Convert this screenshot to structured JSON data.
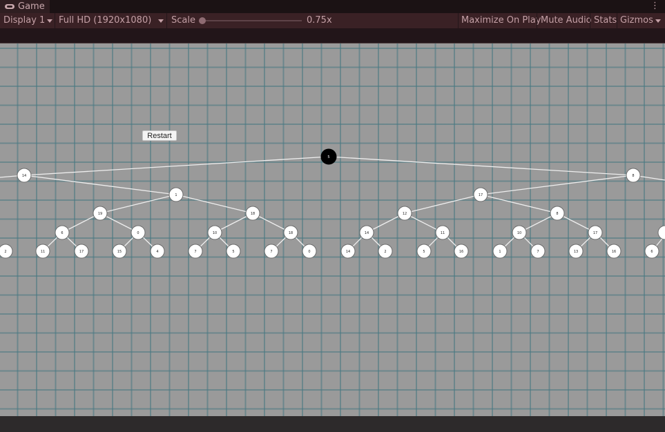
{
  "tab": {
    "title": "Game",
    "icon": "gamepad-icon",
    "menu_icon": "kebab-menu-icon"
  },
  "toolbar": {
    "display": "Display 1",
    "resolution": "Full HD (1920x1080)",
    "scale_label": "Scale",
    "scale_value": "0.75x",
    "maximize": "Maximize On Play",
    "mute": "Mute Audio",
    "stats": "Stats",
    "gizmos": "Gizmos"
  },
  "game": {
    "restart_label": "Restart",
    "root": {
      "label": "5",
      "highlight": true
    },
    "level1": [
      {
        "label": "14"
      },
      {
        "label": "8"
      }
    ],
    "level2": [
      {
        "label": "1"
      },
      {
        "label": "17"
      }
    ],
    "level3": [
      {
        "label": "19"
      },
      {
        "label": "18"
      },
      {
        "label": "12"
      },
      {
        "label": "8"
      }
    ],
    "level4": [
      {
        "label": "6"
      },
      {
        "label": "0"
      },
      {
        "label": "10"
      },
      {
        "label": "18"
      },
      {
        "label": "14"
      },
      {
        "label": "11"
      },
      {
        "label": "10"
      },
      {
        "label": "17"
      }
    ],
    "level5": [
      {
        "label": "2"
      },
      {
        "label": "11"
      },
      {
        "label": "17"
      },
      {
        "label": "15"
      },
      {
        "label": "4"
      },
      {
        "label": "7"
      },
      {
        "label": "5"
      },
      {
        "label": "7"
      },
      {
        "label": "0"
      },
      {
        "label": "14"
      },
      {
        "label": "2"
      },
      {
        "label": "5"
      },
      {
        "label": "16"
      },
      {
        "label": "1"
      },
      {
        "label": "7"
      },
      {
        "label": "13"
      },
      {
        "label": "16"
      },
      {
        "label": "6"
      }
    ]
  }
}
